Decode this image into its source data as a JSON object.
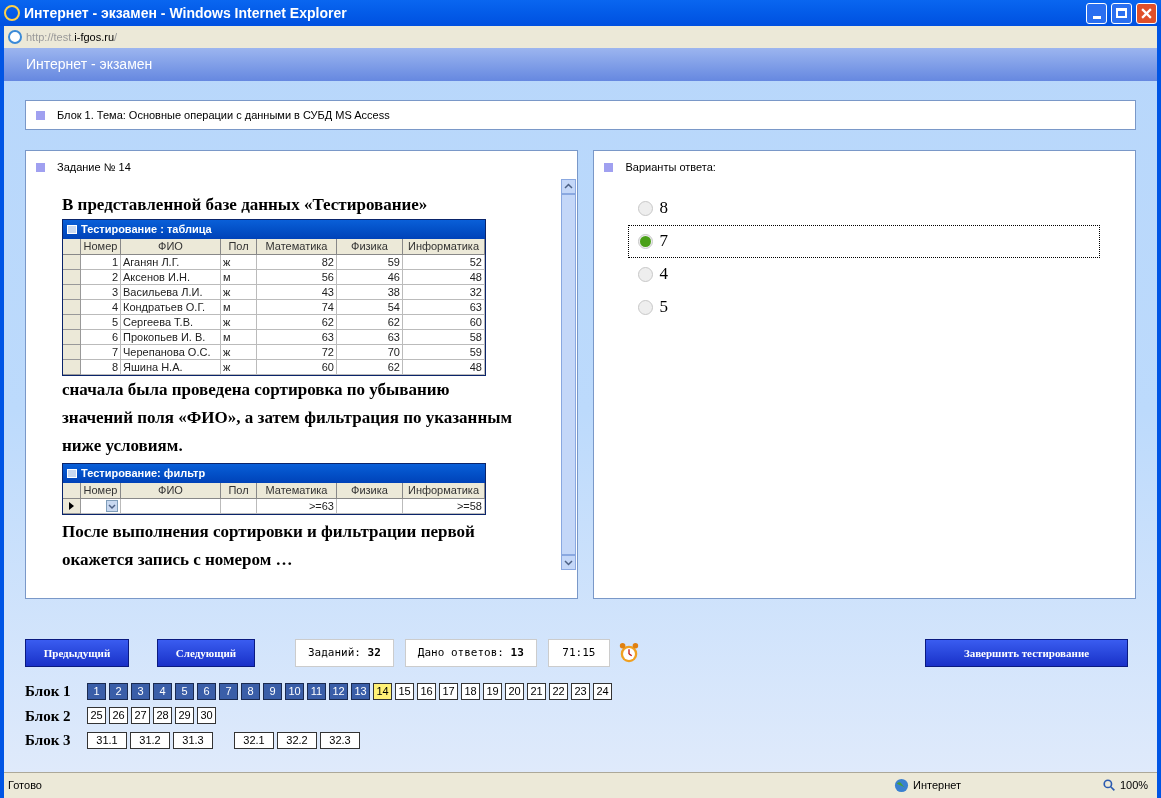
{
  "window": {
    "title": "Интернет - экзамен - Windows Internet Explorer"
  },
  "address": {
    "prefix": "http://test.",
    "domain": "i-fgos.ru",
    "suffix": "/"
  },
  "page_header": "Интернет - экзамен",
  "topic": "Блок 1. Тема: Основные операции с данными в СУБД MS Access",
  "task": {
    "title": "Задание № 14",
    "intro": "В представленной базе данных «Тестирование»",
    "table": {
      "title": "Тестирование : таблица",
      "columns": [
        "Номер",
        "ФИО",
        "Пол",
        "Математика",
        "Физика",
        "Информатика"
      ],
      "rows": [
        [
          "1",
          "Аганян Л.Г.",
          "ж",
          "82",
          "59",
          "52"
        ],
        [
          "2",
          "Аксенов И.Н.",
          "м",
          "56",
          "46",
          "48"
        ],
        [
          "3",
          "Васильева Л.И.",
          "ж",
          "43",
          "38",
          "32"
        ],
        [
          "4",
          "Кондратьев О.Г.",
          "м",
          "74",
          "54",
          "63"
        ],
        [
          "5",
          "Сергеева Т.В.",
          "ж",
          "62",
          "62",
          "60"
        ],
        [
          "6",
          "Прокопьев И. В.",
          "м",
          "63",
          "63",
          "58"
        ],
        [
          "7",
          "Черепанова О.С.",
          "ж",
          "72",
          "70",
          "59"
        ],
        [
          "8",
          "Яшина Н.А.",
          "ж",
          "60",
          "62",
          "48"
        ]
      ]
    },
    "middle": "сначала была проведена сортировка по убыванию значений поля «ФИО», а затем фильтрация по указанным ниже условиям.",
    "filter": {
      "title": "Тестирование: фильтр",
      "columns": [
        {
          "name": "Номер"
        },
        {
          "name": "ФИО"
        },
        {
          "name": "Пол"
        },
        {
          "name": "Математика",
          "condition": ">=63"
        },
        {
          "name": "Физика"
        },
        {
          "name": "Информатика",
          "condition": ">=58"
        }
      ]
    },
    "outro": "После выполнения сортировки и фильтрации первой окажется запись с номером …"
  },
  "answers": {
    "title": "Варианты ответа:",
    "options": [
      {
        "label": "8",
        "selected": false
      },
      {
        "label": "7",
        "selected": true
      },
      {
        "label": "4",
        "selected": false
      },
      {
        "label": "5",
        "selected": false
      }
    ]
  },
  "controls": {
    "prev": "Предыдущий",
    "next": "Следующий",
    "total": {
      "label": "Заданий:",
      "value": "32"
    },
    "answered": {
      "label": "Дано ответов:",
      "value": "13"
    },
    "timer": "71:15",
    "finish": "Завершить тестирование"
  },
  "blocks": [
    {
      "label": "Блок 1",
      "groups": [
        [
          {
            "n": "1",
            "answered": true,
            "selected": false
          },
          {
            "n": "2",
            "answered": true,
            "selected": false
          },
          {
            "n": "3",
            "answered": true,
            "selected": false
          },
          {
            "n": "4",
            "answered": true,
            "selected": false
          },
          {
            "n": "5",
            "answered": true,
            "selected": false
          },
          {
            "n": "6",
            "answered": true,
            "selected": false
          },
          {
            "n": "7",
            "answered": true,
            "selected": false
          },
          {
            "n": "8",
            "answered": true,
            "selected": false
          },
          {
            "n": "9",
            "answered": true,
            "selected": false
          },
          {
            "n": "10",
            "answered": true,
            "selected": false
          },
          {
            "n": "11",
            "answered": true,
            "selected": false
          },
          {
            "n": "12",
            "answered": true,
            "selected": false
          },
          {
            "n": "13",
            "answered": true,
            "selected": false
          },
          {
            "n": "14",
            "selected": true
          },
          {
            "n": "15",
            "answered": false,
            "selected": false
          },
          {
            "n": "16",
            "answered": false,
            "selected": false
          },
          {
            "n": "17",
            "answered": false,
            "selected": false
          },
          {
            "n": "18",
            "answered": false,
            "selected": false
          },
          {
            "n": "19",
            "answered": false,
            "selected": false
          },
          {
            "n": "20",
            "answered": false,
            "selected": false
          },
          {
            "n": "21",
            "answered": false,
            "selected": false
          },
          {
            "n": "22",
            "answered": false,
            "selected": false
          },
          {
            "n": "23",
            "answered": false,
            "selected": false
          },
          {
            "n": "24",
            "answered": false,
            "selected": false
          }
        ]
      ]
    },
    {
      "label": "Блок 2",
      "groups": [
        [
          {
            "n": "25",
            "answered": false,
            "selected": false
          },
          {
            "n": "26",
            "answered": false,
            "selected": false
          },
          {
            "n": "27",
            "answered": false,
            "selected": false
          },
          {
            "n": "28",
            "answered": false,
            "selected": false
          },
          {
            "n": "29",
            "answered": false,
            "selected": false
          },
          {
            "n": "30",
            "answered": false,
            "selected": false
          }
        ]
      ]
    },
    {
      "label": "Блок 3",
      "groups": [
        [
          {
            "n": "31.1",
            "answered": false,
            "selected": false
          },
          {
            "n": "31.2",
            "answered": false,
            "selected": false
          },
          {
            "n": "31.3",
            "answered": false,
            "selected": false
          }
        ],
        [
          {
            "n": "32.1",
            "answered": false,
            "selected": false
          },
          {
            "n": "32.2",
            "answered": false,
            "selected": false
          },
          {
            "n": "32.3",
            "answered": false,
            "selected": false
          }
        ]
      ]
    }
  ],
  "status_bar": {
    "text": "Готово",
    "zone": "Интернет",
    "zoom": "100%"
  }
}
